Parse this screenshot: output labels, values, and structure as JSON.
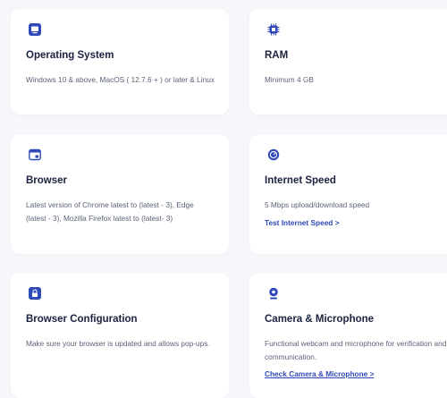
{
  "accent_color": "#2f49b8",
  "cards": [
    {
      "icon": "monitor-icon",
      "title": "Operating System",
      "description": "Windows 10 & above, MacOS ( 12.7.6 + ) or later & Linux"
    },
    {
      "icon": "chip-icon",
      "title": "RAM",
      "description": "Minimum 4 GB"
    },
    {
      "icon": "browser-window-icon",
      "title": "Browser",
      "description": "Latest version of  Chrome latest to (latest - 3), Edge (latest - 3),  Mozilla Firefox latest to (latest- 3)"
    },
    {
      "icon": "speedometer-icon",
      "title": "Internet Speed",
      "description": "5 Mbps upload/download speed",
      "link": "Test Internet Speed >"
    },
    {
      "icon": "lock-icon",
      "title": "Browser Configuration",
      "description": "Make sure your browser is updated and allows pop-ups."
    },
    {
      "icon": "webcam-icon",
      "title": "Camera & Microphone",
      "description": "Functional webcam and microphone for verification and communication.",
      "link": "Check Camera & Microphone >"
    }
  ]
}
